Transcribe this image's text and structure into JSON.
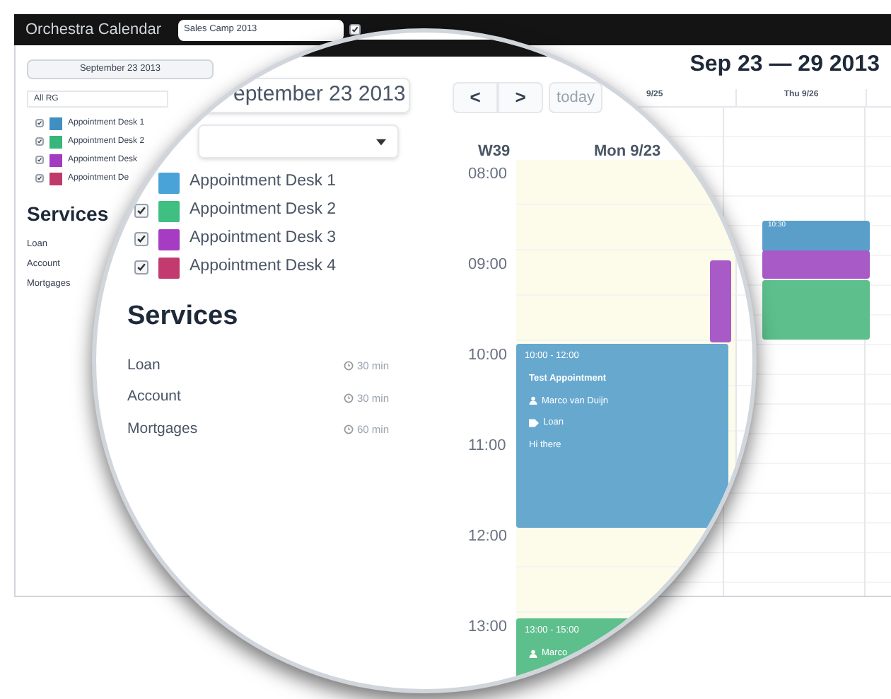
{
  "top_bar": {
    "title": "Orchestra Calendar",
    "event_select": "Sales Camp 2013",
    "save_checked": true
  },
  "sidebar": {
    "date_button": "September 23 2013",
    "group_select": "All RG",
    "desks": [
      {
        "label": "Appointment Desk 1",
        "color": "#3f8fc2",
        "checked": true
      },
      {
        "label": "Appointment Desk 2",
        "color": "#38b57a",
        "checked": true
      },
      {
        "label": "Appointment Desk",
        "color": "#a23bbf",
        "checked": true
      },
      {
        "label": "Appointment De",
        "color": "#bf3a6b",
        "checked": true
      }
    ],
    "services_title": "Services",
    "services": [
      "Loan",
      "Account",
      "Mortgages"
    ]
  },
  "calendar": {
    "title": "Sep 23 — 29 2013",
    "day_headers": [
      "9/25",
      "Thu 9/26"
    ],
    "events": [
      {
        "time": "10:30",
        "color": "#5a9fca"
      },
      {
        "color": "#a85bc6"
      },
      {
        "color": "#5cbf8c"
      }
    ]
  },
  "magnifier": {
    "date_field": "eptember 23 2013",
    "desks": [
      {
        "label": "Appointment Desk 1",
        "color": "#4aa3d8"
      },
      {
        "label": "Appointment Desk 2",
        "color": "#3fbf82",
        "checked": true
      },
      {
        "label": "Appointment Desk 3",
        "color": "#a63cc2",
        "checked": true
      },
      {
        "label": "Appointment Desk 4",
        "color": "#c23a6e",
        "checked": true
      }
    ],
    "services_title": "Services",
    "services": [
      {
        "name": "Loan",
        "duration": "30 min"
      },
      {
        "name": "Account",
        "duration": "30 min"
      },
      {
        "name": "Mortgages",
        "duration": "60 min"
      }
    ],
    "prev": "<",
    "next": ">",
    "today": "today",
    "week": "W39",
    "day": "Mon 9/23",
    "times": [
      "08:00",
      "09:00",
      "10:00",
      "11:00",
      "12:00",
      "13:00"
    ],
    "events": [
      {
        "time": "10:00 - 12:00",
        "title": "Test Appointment",
        "person": "Marco van Duijn",
        "service": "Loan",
        "note": "Hi there",
        "color": "#67a8cf"
      },
      {
        "time": "13:00 - 15:00",
        "person": "Marco",
        "color": "#5dbf8c"
      }
    ]
  }
}
